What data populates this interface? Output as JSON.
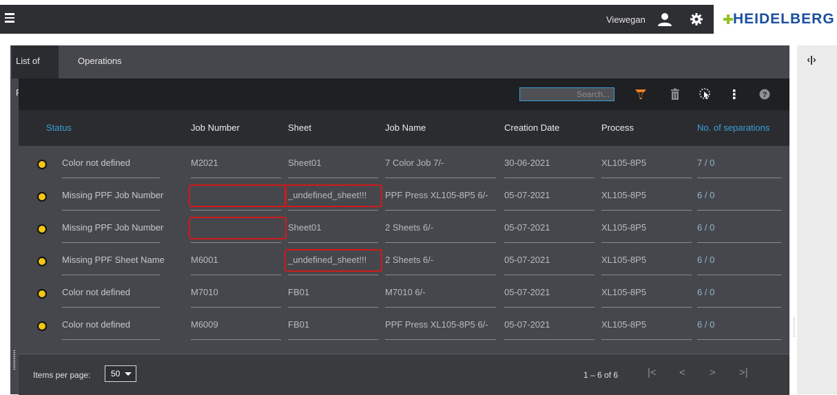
{
  "header": {
    "user": "Viewegan",
    "logo": "HEIDELBERG",
    "icons": [
      "menu-icon",
      "user-icon",
      "gear-icon"
    ]
  },
  "tabs": [
    {
      "label": "List of PPF",
      "active": true
    },
    {
      "label": "Operations",
      "active": false
    }
  ],
  "toolbar": {
    "search_placeholder": "Search...",
    "icons": [
      "filter-icon",
      "delete-icon",
      "select-icon",
      "more-icon",
      "help-icon"
    ]
  },
  "table": {
    "columns": [
      "Status",
      "Job Number",
      "Sheet",
      "Job Name",
      "Creation Date",
      "Process",
      "No. of separations"
    ],
    "rows": [
      {
        "status": "Color not defined",
        "job_number": "M2021",
        "sheet": "Sheet01",
        "job_name": "7 Color Job 7/-",
        "date": "30-06-2021",
        "process": "XL105-8P5",
        "separations": "7 / 0"
      },
      {
        "status": "Missing PPF Job Number",
        "job_number": "",
        "sheet": "_undefined_sheet!!!",
        "job_name": "PPF Press XL105-8P5 6/-",
        "date": "05-07-2021",
        "process": "XL105-8P5",
        "separations": "6 / 0"
      },
      {
        "status": "Missing PPF Job Number",
        "job_number": "",
        "sheet": "Sheet01",
        "job_name": "2 Sheets 6/-",
        "date": "05-07-2021",
        "process": "XL105-8P5",
        "separations": "6 / 0"
      },
      {
        "status": "Missing PPF Sheet Name",
        "job_number": "M6001",
        "sheet": "_undefined_sheet!!!",
        "job_name": "2 Sheets 6/-",
        "date": "05-07-2021",
        "process": "XL105-8P5",
        "separations": "6 / 0"
      },
      {
        "status": "Color not defined",
        "job_number": "M7010",
        "sheet": "FB01",
        "job_name": "M7010 6/-",
        "date": "05-07-2021",
        "process": "XL105-8P5",
        "separations": "6 / 0"
      },
      {
        "status": "Color not defined",
        "job_number": "M6009",
        "sheet": "FB01",
        "job_name": "PPF Press XL105-8P5 6/-",
        "date": "05-07-2021",
        "process": "XL105-8P5",
        "separations": "6 / 0"
      }
    ]
  },
  "footer": {
    "items_per_page_label": "Items per page:",
    "items_per_page": "50",
    "range": "1 – 6 of 6",
    "pager": {
      "first": "|<",
      "prev": "<",
      "next": ">",
      "last": ">|"
    }
  },
  "side": {
    "toggle": "‹|›"
  },
  "colors": {
    "accent": "#3aa0d8",
    "status_warning": "#f3c613",
    "highlight": "#d11a1a",
    "filter": "#f0821e",
    "logo": "#1b4ea0"
  }
}
